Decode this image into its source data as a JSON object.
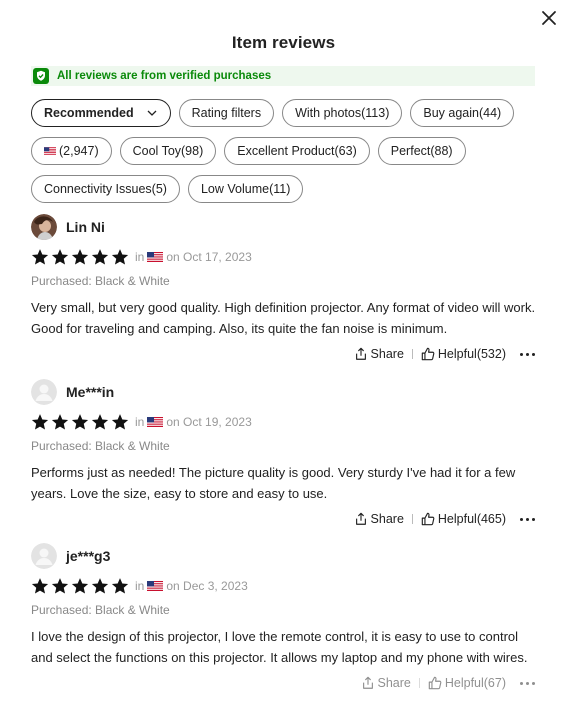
{
  "header": {
    "title": "Item reviews",
    "close_icon": "close-icon"
  },
  "verified": {
    "text": "All reviews are from verified purchases",
    "icon": "shield-check-icon",
    "color": "#0a8a0a"
  },
  "filters": {
    "sort_label": "Recommended",
    "chips": [
      {
        "label": "Rating filters"
      },
      {
        "label": "With photos(113)"
      },
      {
        "label": "Buy again(44)"
      },
      {
        "label": "(2,947)",
        "icon": "us-flag-icon"
      },
      {
        "label": "Cool Toy(98)"
      },
      {
        "label": "Excellent Product(63)"
      },
      {
        "label": "Perfect(88)"
      },
      {
        "label": "Connectivity Issues(5)"
      },
      {
        "label": "Low Volume(11)"
      }
    ]
  },
  "reviews": [
    {
      "name": "Lin Ni",
      "rating": 5,
      "in_label": "in",
      "date": "on Oct 17, 2023",
      "purchased": "Purchased: Black & White",
      "text": "Very small, but very good quality. High definition projector. Any format of video will work. Good for traveling and camping. Also, its quite the fan noise is minimum.",
      "share_label": "Share",
      "helpful_label": "Helpful(532)"
    },
    {
      "name": "Me***in",
      "rating": 5,
      "in_label": "in",
      "date": "on Oct 19, 2023",
      "purchased": "Purchased: Black & White",
      "text": "Performs just as needed! The picture quality is good. Very sturdy I've had it for a few years. Love the size, easy to store and easy to use.",
      "share_label": "Share",
      "helpful_label": "Helpful(465)"
    },
    {
      "name": "je***g3",
      "rating": 5,
      "in_label": "in",
      "date": "on Dec 3, 2023",
      "purchased": "Purchased: Black & White",
      "text": "I love the design of this projector, I love the remote control, it is easy to use to control and select the functions on this projector. It allows my laptop and my phone with wires.",
      "share_label": "Share",
      "helpful_label": "Helpful(67)"
    }
  ]
}
